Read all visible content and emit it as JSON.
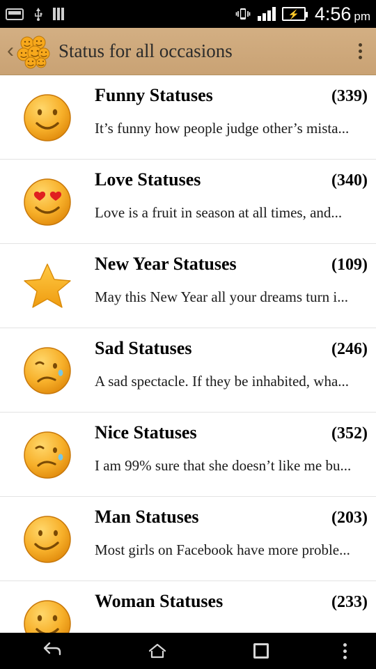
{
  "statusbar": {
    "time": "4:56",
    "ampm": "pm",
    "icons": [
      "sd-card-icon",
      "usb-icon",
      "signal-bars-icon",
      "vibrate-icon",
      "cell-signal-icon",
      "battery-charging-icon"
    ]
  },
  "actionbar": {
    "back_label": "‹",
    "title": "Status for all occasions",
    "logo": "smiley-cluster-icon",
    "overflow_label": "overflow-menu"
  },
  "list": [
    {
      "icon": "smiley-happy-icon",
      "title": "Funny Statuses",
      "count": "(339)",
      "snippet": "It’s funny how people judge other’s mista..."
    },
    {
      "icon": "smiley-heart-eyes-icon",
      "title": "Love Statuses",
      "count": "(340)",
      "snippet": "Love is a fruit in season at all times, and..."
    },
    {
      "icon": "star-icon",
      "title": "New Year Statuses",
      "count": "(109)",
      "snippet": "May this New Year all your dreams turn i..."
    },
    {
      "icon": "smiley-sad-tear-icon",
      "title": "Sad Statuses",
      "count": "(246)",
      "snippet": "A sad spectacle. If they be inhabited, wha..."
    },
    {
      "icon": "smiley-sad-tear-icon",
      "title": "Nice Statuses",
      "count": "(352)",
      "snippet": "I am 99% sure that she doesn’t like me bu..."
    },
    {
      "icon": "smiley-smirk-icon",
      "title": "Man Statuses",
      "count": "(203)",
      "snippet": "Most girls on Facebook have more proble..."
    },
    {
      "icon": "smiley-happy-icon",
      "title": "Woman Statuses",
      "count": "(233)",
      "snippet": ""
    }
  ],
  "navbar": {
    "back": "nav-back-icon",
    "home": "nav-home-icon",
    "recents": "nav-recents-icon",
    "more": "nav-more-icon"
  },
  "colors": {
    "actionbar": "#cfa97a",
    "statusbar": "#000000",
    "divider": "#e3e3e3",
    "emoji_yellow": "#f6b93b"
  }
}
